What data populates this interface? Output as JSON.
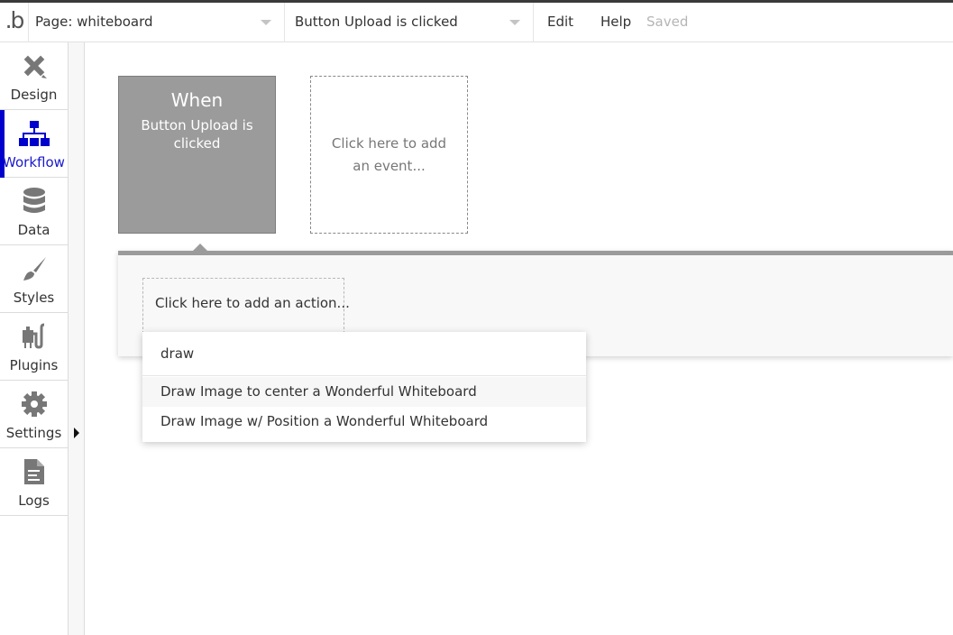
{
  "topbar": {
    "logo": ".b",
    "page_dropdown": "Page: whiteboard",
    "event_dropdown": "Button Upload is clicked",
    "menu": {
      "edit": "Edit",
      "help": "Help"
    },
    "status": "Saved"
  },
  "sidebar": {
    "items": [
      {
        "label": "Design",
        "icon": "design-icon",
        "active": false
      },
      {
        "label": "Workflow",
        "icon": "workflow-icon",
        "active": true
      },
      {
        "label": "Data",
        "icon": "database-icon",
        "active": false
      },
      {
        "label": "Styles",
        "icon": "brush-icon",
        "active": false
      },
      {
        "label": "Plugins",
        "icon": "plug-icon",
        "active": false
      },
      {
        "label": "Settings",
        "icon": "gear-icon",
        "active": false
      },
      {
        "label": "Logs",
        "icon": "document-icon",
        "active": false
      }
    ]
  },
  "workflow": {
    "event_card": {
      "heading": "When",
      "event": "Button Upload is clicked"
    },
    "add_event": "Click here to add an event...",
    "add_action": "Click here to add an action...",
    "action_search": {
      "value": "draw",
      "options": [
        {
          "label": "Draw Image to center a Wonderful Whiteboard",
          "highlighted": true
        },
        {
          "label": "Draw Image w/ Position a Wonderful Whiteboard",
          "highlighted": false
        }
      ]
    }
  },
  "colors": {
    "accent": "#0000cc",
    "event_card": "#9b9b9b"
  }
}
